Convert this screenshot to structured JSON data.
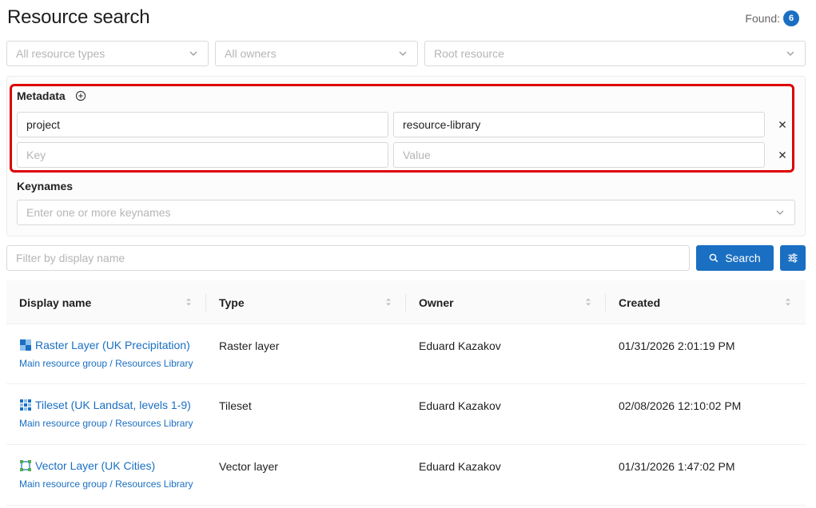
{
  "header": {
    "title": "Resource search",
    "found_label": "Found:",
    "found_count": "6"
  },
  "filters": {
    "resource_types_placeholder": "All resource types",
    "owners_placeholder": "All owners",
    "root_resource_placeholder": "Root resource"
  },
  "metadata": {
    "label": "Metadata",
    "rows": [
      {
        "key": "project",
        "value": "resource-library"
      },
      {
        "key_placeholder": "Key",
        "value_placeholder": "Value"
      }
    ]
  },
  "keynames": {
    "label": "Keynames",
    "placeholder": "Enter one or more keynames"
  },
  "search": {
    "filter_placeholder": "Filter by display name",
    "search_label": "Search"
  },
  "table": {
    "columns": [
      "Display name",
      "Type",
      "Owner",
      "Created"
    ],
    "rows": [
      {
        "name": "Raster Layer (UK Precipitation)",
        "path_group": "Main resource group",
        "path_sep": "/",
        "path_library": "Resources Library",
        "type": "Raster layer",
        "owner": "Eduard Kazakov",
        "created": "01/31/2026 2:01:19 PM",
        "icon": "raster-layer-icon"
      },
      {
        "name": "Tileset (UK Landsat, levels 1-9)",
        "path_group": "Main resource group",
        "path_sep": "/",
        "path_library": "Resources Library",
        "type": "Tileset",
        "owner": "Eduard Kazakov",
        "created": "02/08/2026 12:10:02 PM",
        "icon": "tileset-icon"
      },
      {
        "name": "Vector Layer (UK Cities)",
        "path_group": "Main resource group",
        "path_sep": "/",
        "path_library": "Resources Library",
        "type": "Vector layer",
        "owner": "Eduard Kazakov",
        "created": "01/31/2026 1:47:02 PM",
        "icon": "vector-layer-icon"
      }
    ]
  },
  "colors": {
    "accent": "#1a6fc2",
    "highlight_border": "#dd0000"
  }
}
